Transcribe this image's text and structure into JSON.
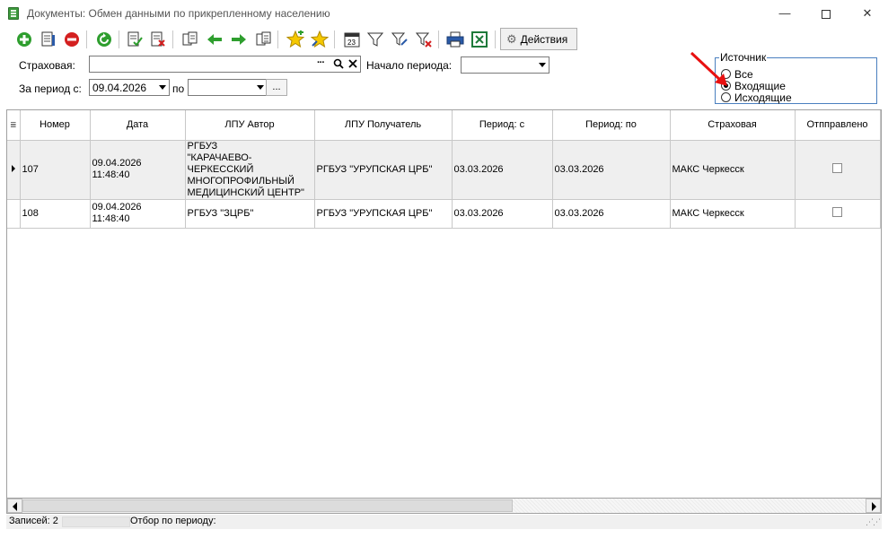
{
  "window": {
    "title": "Документы: Обмен данными по прикрепленному населению",
    "min_glyph": "—",
    "close_glyph": "✕"
  },
  "toolbar": {
    "actions_label": "Действия",
    "icons": [
      "add-icon",
      "edit-doc-icon",
      "delete-icon",
      "refresh-icon",
      "check-doc-icon",
      "cancel-doc-icon",
      "copy-doc-icon",
      "arrow-left-icon",
      "arrow-right-icon",
      "paste-doc-icon",
      "star-add-icon",
      "star-icon",
      "calendar-icon",
      "filter-icon",
      "filter-edit-icon",
      "filter-clear-icon",
      "print-icon",
      "excel-icon"
    ]
  },
  "filters": {
    "insurer_label": "Страховая:",
    "insurer_value": "",
    "period_start_label": "Начало периода:",
    "period_start_value": "",
    "period_from_label": "За период с:",
    "period_from_value": "09.04.2026",
    "period_to_label": "по",
    "period_to_value": "",
    "dots_label": "...",
    "lookup_ellipsis": "···"
  },
  "source": {
    "title": "Источник",
    "options": [
      {
        "label": "Все",
        "selected": false
      },
      {
        "label": "Входящие",
        "selected": true
      },
      {
        "label": "Исходящие",
        "selected": false
      }
    ]
  },
  "grid": {
    "columns": [
      "Номер",
      "Дата",
      "ЛПУ Автор",
      "ЛПУ Получатель",
      "Период: с",
      "Период: по",
      "Страховая",
      "Отпправлено"
    ],
    "rows": [
      {
        "number": "107",
        "date_line1": "09.04.2026",
        "date_line2": "11:48:40",
        "author_lines": [
          "РГБУЗ",
          "\"КАРАЧАЕВО-ЧЕРКЕССКИЙ",
          "МНОГОПРОФИЛЬНЫЙ",
          "МЕДИЦИНСКИЙ ЦЕНТР\""
        ],
        "recipient": "РГБУЗ \"УРУПСКАЯ ЦРБ\"",
        "period_from": "03.03.2026",
        "period_to": "03.03.2026",
        "insurer": "МАКС Черкесск",
        "sent": false,
        "current": true
      },
      {
        "number": "108",
        "date_line1": "09.04.2026",
        "date_line2": "11:48:40",
        "author_lines": [
          "РГБУЗ \"ЗЦРБ\""
        ],
        "recipient": "РГБУЗ \"УРУПСКАЯ ЦРБ\"",
        "period_from": "03.03.2026",
        "period_to": "03.03.2026",
        "insurer": "МАКС Черкесск",
        "sent": false,
        "current": false
      }
    ]
  },
  "status": {
    "count_text": "Записей:  2",
    "period_text": "Отбор по периоду:"
  },
  "colors": {
    "annotation_arrow": "#e81010",
    "group_border": "#4a7fbf",
    "selected_row_bg": "#efefef"
  }
}
